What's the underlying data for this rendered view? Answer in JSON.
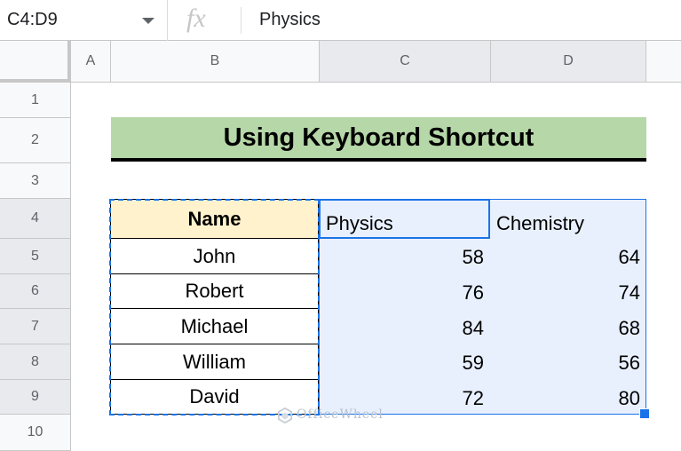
{
  "formula_bar": {
    "name_box": "C4:D9",
    "fx_label": "fx",
    "formula": "Physics"
  },
  "columns": [
    "A",
    "B",
    "C",
    "D"
  ],
  "rows": [
    "1",
    "2",
    "3",
    "4",
    "5",
    "6",
    "7",
    "8",
    "9",
    "10"
  ],
  "sheet": {
    "title": "Using Keyboard Shortcut",
    "headers": {
      "name": "Name",
      "physics": "Physics",
      "chemistry": "Chemistry"
    },
    "records": [
      {
        "name": "John",
        "physics": "58",
        "chemistry": "64"
      },
      {
        "name": "Robert",
        "physics": "76",
        "chemistry": "74"
      },
      {
        "name": "Michael",
        "physics": "84",
        "chemistry": "68"
      },
      {
        "name": "William",
        "physics": "59",
        "chemistry": "56"
      },
      {
        "name": "David",
        "physics": "72",
        "chemistry": "80"
      }
    ]
  },
  "watermark": "OfficeWheel",
  "colors": {
    "title_bg": "#b6d7a8",
    "header_bg": "#fff2cc",
    "selection_bg": "#e8f0fe",
    "selection_border": "#1a73e8"
  }
}
